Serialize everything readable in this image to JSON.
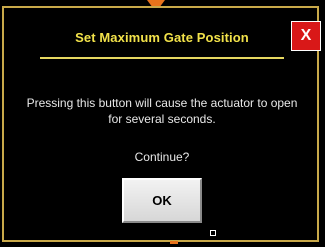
{
  "dialog": {
    "title": "Set Maximum Gate Position",
    "close_glyph": "X",
    "message": "Pressing this button will cause the actuator to open for several seconds.",
    "prompt": "Continue?",
    "ok_label": "OK"
  },
  "colors": {
    "background": "#000000",
    "title_text": "#f2e24a",
    "close_button": "#d91818",
    "accent_orange": "#e8731c",
    "border_gold": "#c9a94a"
  },
  "icons": {
    "close": "close-icon",
    "pointer": "orange-pointer-arrow"
  }
}
